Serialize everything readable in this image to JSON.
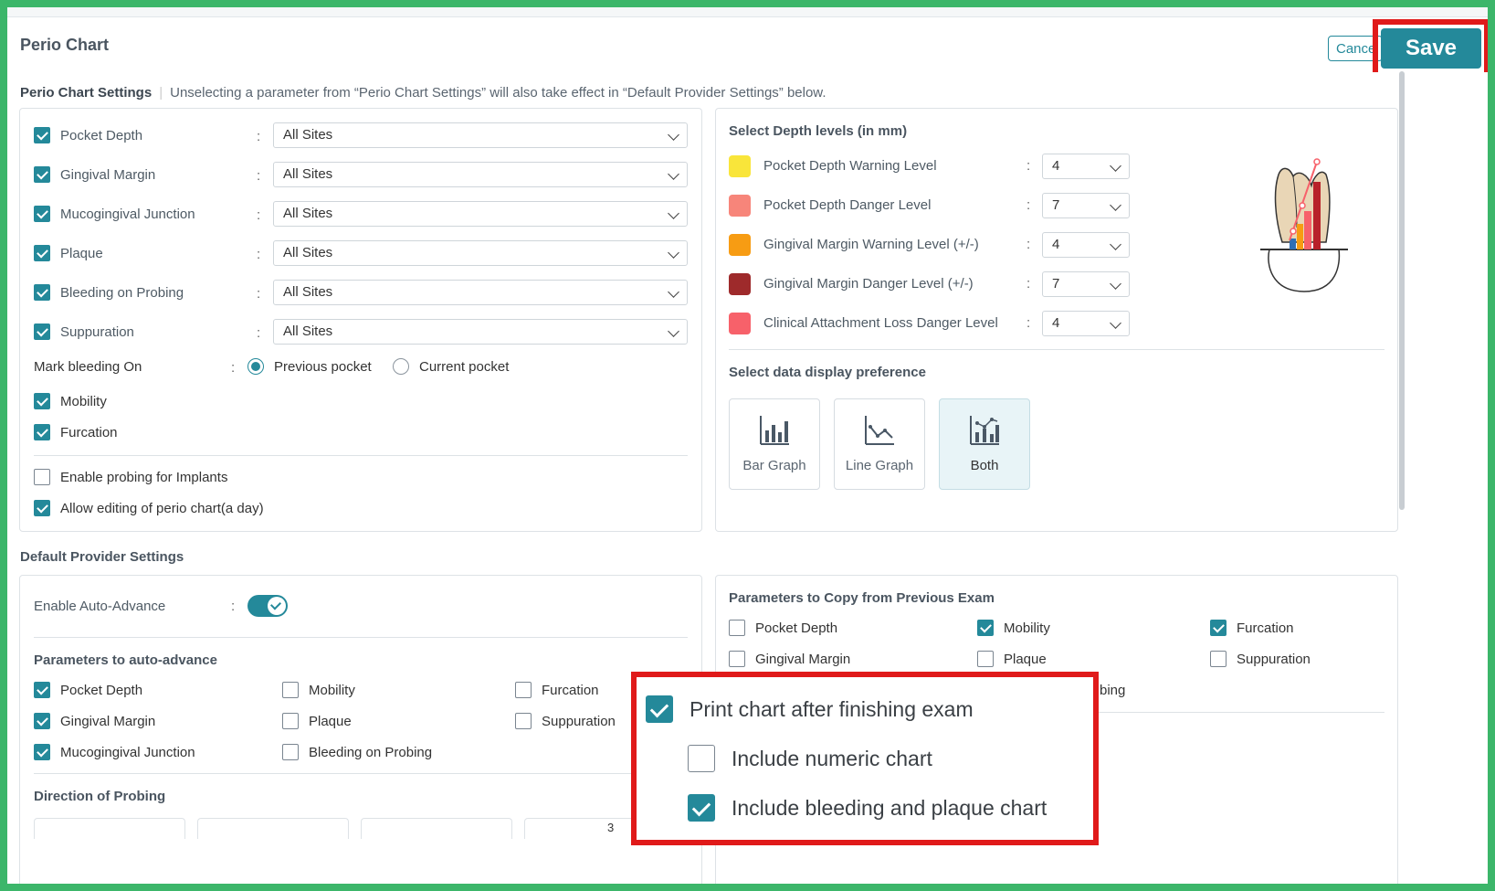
{
  "header": {
    "title": "Perio Chart",
    "cancel_label": "Cancel",
    "save_label": "Save"
  },
  "subhead": {
    "title": "Perio Chart Settings",
    "note": "Unselecting a parameter from “Perio Chart Settings” will also take effect in “Default Provider Settings” below."
  },
  "perio_params": [
    {
      "label": "Pocket Depth",
      "checked": true,
      "value": "All Sites"
    },
    {
      "label": "Gingival Margin",
      "checked": true,
      "value": "All Sites"
    },
    {
      "label": "Mucogingival Junction",
      "checked": true,
      "value": "All Sites"
    },
    {
      "label": "Plaque",
      "checked": true,
      "value": "All Sites"
    },
    {
      "label": "Bleeding on Probing",
      "checked": true,
      "value": "All Sites"
    },
    {
      "label": "Suppuration",
      "checked": true,
      "value": "All Sites"
    }
  ],
  "mark_bleeding": {
    "label": "Mark bleeding On",
    "options": [
      "Previous pocket",
      "Current pocket"
    ],
    "selected": "Previous pocket"
  },
  "extra_params": [
    {
      "label": "Mobility",
      "checked": true
    },
    {
      "label": "Furcation",
      "checked": true
    }
  ],
  "misc_options": [
    {
      "label": "Enable probing for Implants",
      "checked": false
    },
    {
      "label": "Allow editing of perio chart(a day)",
      "checked": true
    }
  ],
  "depth_levels": {
    "title": "Select Depth levels (in mm)",
    "items": [
      {
        "label": "Pocket Depth Warning Level",
        "color": "#f9e53a",
        "value": "4"
      },
      {
        "label": "Pocket Depth Danger Level",
        "color": "#f7857a",
        "value": "7"
      },
      {
        "label": "Gingival Margin Warning Level (+/-)",
        "color": "#f79c13",
        "value": "4"
      },
      {
        "label": "Gingival Margin Danger Level (+/-)",
        "color": "#9e2a2b",
        "value": "7"
      },
      {
        "label": "Clinical Attachment Loss Danger Level",
        "color": "#f7616a",
        "value": "4"
      }
    ]
  },
  "display_pref": {
    "title": "Select data display preference",
    "options": [
      {
        "label": "Bar Graph",
        "icon": "bar-graph-icon"
      },
      {
        "label": "Line Graph",
        "icon": "line-graph-icon"
      },
      {
        "label": "Both",
        "icon": "both-graph-icon"
      }
    ],
    "selected": "Both"
  },
  "default_provider": {
    "title": "Default Provider Settings",
    "auto_advance_label": "Enable Auto-Advance",
    "auto_advance_on": true,
    "params_title": "Parameters to auto-advance",
    "params": [
      {
        "label": "Pocket Depth",
        "checked": true
      },
      {
        "label": "Mobility",
        "checked": false
      },
      {
        "label": "Furcation",
        "checked": false
      },
      {
        "label": "Gingival Margin",
        "checked": true
      },
      {
        "label": "Plaque",
        "checked": false
      },
      {
        "label": "Suppuration",
        "checked": false
      },
      {
        "label": "Mucogingival Junction",
        "checked": true
      },
      {
        "label": "Bleeding on Probing",
        "checked": false
      }
    ],
    "direction_title": "Direction of Probing",
    "direction_partial": "3"
  },
  "copy_params": {
    "title": "Parameters to Copy from Previous Exam",
    "items": [
      {
        "label": "Pocket Depth",
        "checked": false
      },
      {
        "label": "Mobility",
        "checked": true
      },
      {
        "label": "Furcation",
        "checked": true
      },
      {
        "label": "Gingival Margin",
        "checked": false
      },
      {
        "label": "Plaque",
        "checked": false
      },
      {
        "label": "Suppuration",
        "checked": false
      }
    ],
    "partial_label": "bing"
  },
  "print_options": [
    {
      "label": "Print chart after finishing exam",
      "checked": true
    },
    {
      "label": "Include numeric chart",
      "checked": false
    },
    {
      "label": "Include bleeding and plaque chart",
      "checked": true
    }
  ],
  "colors": {
    "accent": "#24899a",
    "highlight": "#e01a1a",
    "frame": "#3cb66a"
  }
}
